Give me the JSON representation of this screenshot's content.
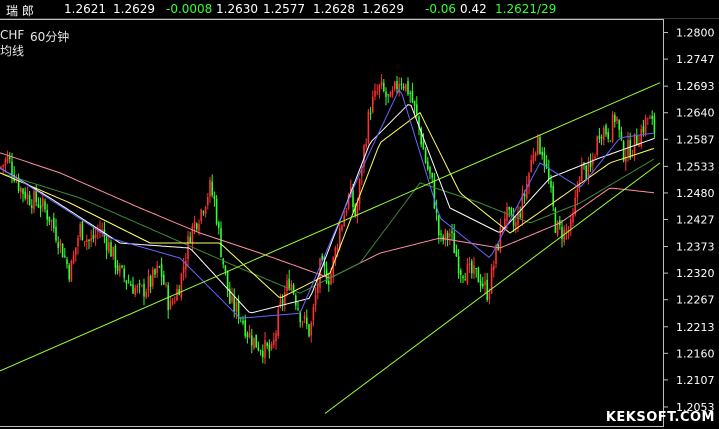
{
  "quote_bar": {
    "symbol": "瑞  郎",
    "fields": [
      "1.2621",
      "1.2629",
      "-0.0008",
      "1.2630",
      "1.2577",
      "1.2628",
      "1.2629",
      "-0.06",
      "0.42",
      "1.2621/29"
    ],
    "colors": [
      "#ffffff",
      "#ffffff",
      "#33ff33",
      "#ffffff",
      "#ffffff",
      "#ffffff",
      "#ffffff",
      "#33ff33",
      "#ffffff",
      "#33ff33"
    ]
  },
  "chart_header": {
    "symbol_fragment": "CHF",
    "period": "60分钟",
    "line_type": "均线"
  },
  "watermark": "KEKSOFT.COM",
  "colors": {
    "up_candle": "#ff3030",
    "down_candle": "#33ff33",
    "ma_short": "#ffffff",
    "ma_mid": "#ffff66",
    "ma_blue": "#6666ff",
    "ma_long_green": "#3a8a3a",
    "ma_longest": "#ff8fa0",
    "trendline": "#99ff33",
    "axis_text": "#ffffff"
  },
  "chart_data": {
    "type": "candlestick",
    "y_ticks": [
      "1.2800",
      "1.2747",
      "1.2693",
      "1.2640",
      "1.2587",
      "1.2533",
      "1.2480",
      "1.2427",
      "1.2373",
      "1.2320",
      "1.2267",
      "1.2213",
      "1.2160",
      "1.2107",
      "1.2053"
    ],
    "ylim": [
      1.2015,
      1.2825
    ],
    "close_anchors": [
      [
        0,
        1.253
      ],
      [
        8,
        1.255
      ],
      [
        20,
        1.249
      ],
      [
        30,
        1.247
      ],
      [
        40,
        1.246
      ],
      [
        50,
        1.243
      ],
      [
        60,
        1.238
      ],
      [
        70,
        1.232
      ],
      [
        80,
        1.241
      ],
      [
        90,
        1.238
      ],
      [
        100,
        1.241
      ],
      [
        110,
        1.237
      ],
      [
        120,
        1.232
      ],
      [
        130,
        1.23
      ],
      [
        140,
        1.228
      ],
      [
        150,
        1.23
      ],
      [
        160,
        1.233
      ],
      [
        170,
        1.225
      ],
      [
        180,
        1.23
      ],
      [
        190,
        1.24
      ],
      [
        200,
        1.244
      ],
      [
        210,
        1.249
      ],
      [
        215,
        1.246
      ],
      [
        220,
        1.238
      ],
      [
        230,
        1.226
      ],
      [
        240,
        1.224
      ],
      [
        248,
        1.22
      ],
      [
        256,
        1.218
      ],
      [
        264,
        1.217
      ],
      [
        272,
        1.216
      ],
      [
        280,
        1.225
      ],
      [
        290,
        1.231
      ],
      [
        300,
        1.224
      ],
      [
        310,
        1.22
      ],
      [
        320,
        1.233
      ],
      [
        330,
        1.231
      ],
      [
        340,
        1.241
      ],
      [
        350,
        1.248
      ],
      [
        356,
        1.243
      ],
      [
        362,
        1.254
      ],
      [
        370,
        1.265
      ],
      [
        380,
        1.269
      ],
      [
        390,
        1.266
      ],
      [
        400,
        1.271
      ],
      [
        410,
        1.268
      ],
      [
        418,
        1.262
      ],
      [
        426,
        1.254
      ],
      [
        432,
        1.25
      ],
      [
        440,
        1.238
      ],
      [
        450,
        1.24
      ],
      [
        460,
        1.233
      ],
      [
        470,
        1.232
      ],
      [
        480,
        1.231
      ],
      [
        488,
        1.228
      ],
      [
        496,
        1.236
      ],
      [
        505,
        1.244
      ],
      [
        515,
        1.241
      ],
      [
        525,
        1.248
      ],
      [
        535,
        1.258
      ],
      [
        542,
        1.257
      ],
      [
        548,
        1.251
      ],
      [
        556,
        1.241
      ],
      [
        564,
        1.24
      ],
      [
        572,
        1.241
      ],
      [
        580,
        1.253
      ],
      [
        590,
        1.252
      ],
      [
        600,
        1.261
      ],
      [
        610,
        1.26
      ],
      [
        616,
        1.264
      ],
      [
        622,
        1.256
      ],
      [
        632,
        1.257
      ],
      [
        640,
        1.26
      ],
      [
        648,
        1.263
      ],
      [
        656,
        1.26
      ]
    ],
    "moving_averages": [
      {
        "color_key": "ma_longest",
        "anchors": [
          [
            0,
            1.256
          ],
          [
            60,
            1.252
          ],
          [
            140,
            1.245
          ],
          [
            200,
            1.24
          ],
          [
            260,
            1.236
          ],
          [
            330,
            1.231
          ],
          [
            380,
            1.236
          ],
          [
            440,
            1.239
          ],
          [
            500,
            1.237
          ],
          [
            560,
            1.242
          ],
          [
            610,
            1.249
          ],
          [
            656,
            1.248
          ]
        ]
      },
      {
        "color_key": "ma_long_green",
        "anchors": [
          [
            0,
            1.252
          ],
          [
            80,
            1.247
          ],
          [
            160,
            1.24
          ],
          [
            240,
            1.233
          ],
          [
            300,
            1.228
          ],
          [
            360,
            1.234
          ],
          [
            420,
            1.25
          ],
          [
            480,
            1.246
          ],
          [
            530,
            1.242
          ],
          [
            580,
            1.246
          ],
          [
            656,
            1.255
          ]
        ]
      },
      {
        "color_key": "ma_mid",
        "anchors": [
          [
            0,
            1.252
          ],
          [
            70,
            1.246
          ],
          [
            150,
            1.238
          ],
          [
            220,
            1.238
          ],
          [
            280,
            1.227
          ],
          [
            330,
            1.232
          ],
          [
            380,
            1.258
          ],
          [
            420,
            1.264
          ],
          [
            460,
            1.248
          ],
          [
            510,
            1.24
          ],
          [
            560,
            1.247
          ],
          [
            610,
            1.254
          ],
          [
            656,
            1.257
          ]
        ]
      },
      {
        "color_key": "ma_short",
        "anchors": [
          [
            0,
            1.253
          ],
          [
            50,
            1.247
          ],
          [
            120,
            1.238
          ],
          [
            190,
            1.237
          ],
          [
            250,
            1.224
          ],
          [
            310,
            1.227
          ],
          [
            370,
            1.258
          ],
          [
            410,
            1.266
          ],
          [
            450,
            1.245
          ],
          [
            500,
            1.24
          ],
          [
            550,
            1.251
          ],
          [
            600,
            1.255
          ],
          [
            656,
            1.259
          ]
        ]
      },
      {
        "color_key": "ma_blue",
        "anchors": [
          [
            0,
            1.253
          ],
          [
            40,
            1.248
          ],
          [
            110,
            1.239
          ],
          [
            180,
            1.235
          ],
          [
            240,
            1.223
          ],
          [
            300,
            1.224
          ],
          [
            360,
            1.252
          ],
          [
            400,
            1.269
          ],
          [
            440,
            1.243
          ],
          [
            490,
            1.235
          ],
          [
            540,
            1.254
          ],
          [
            580,
            1.249
          ],
          [
            620,
            1.259
          ],
          [
            656,
            1.26
          ]
        ]
      }
    ],
    "trendlines": [
      {
        "from": [
          0,
          1.2125
        ],
        "to": [
          660,
          1.27
        ]
      },
      {
        "from": [
          325,
          1.204
        ],
        "to": [
          660,
          1.254
        ]
      }
    ]
  }
}
